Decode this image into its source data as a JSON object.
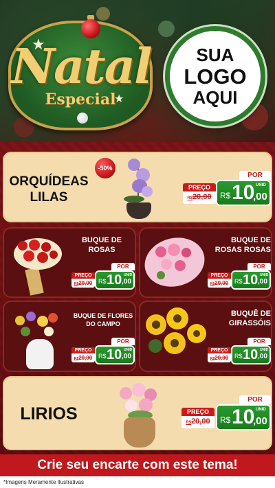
{
  "header": {
    "seal_title": "Natal",
    "seal_subtitle": "Especial",
    "logo_lines": [
      "SUA",
      "LOGO",
      "AQUI"
    ]
  },
  "discount_badge": "-50%",
  "products": [
    {
      "name_lines": [
        "ORQUÍDEAS",
        "LILAS"
      ],
      "price_label": "PREÇO",
      "old_price": "20,00",
      "old_currency": "R$",
      "por_label": "POR",
      "currency": "R$",
      "price_int": "10",
      "price_dec": ",00",
      "unit": "UNID"
    },
    {
      "name_lines": [
        "BUQUE DE",
        "ROSAS"
      ],
      "price_label": "PREÇO",
      "old_price": "20,00",
      "old_currency": "R$",
      "por_label": "POR",
      "currency": "R$",
      "price_int": "10",
      "price_dec": ",00",
      "unit": "UNID"
    },
    {
      "name_lines": [
        "BUQUE DE",
        "ROSAS ROSAS"
      ],
      "price_label": "PREÇO",
      "old_price": "20,00",
      "old_currency": "R$",
      "por_label": "POR",
      "currency": "R$",
      "price_int": "10",
      "price_dec": ",00",
      "unit": "UNID"
    },
    {
      "name_lines": [
        "BUQUE DE FLORES",
        "DO CAMPO"
      ],
      "price_label": "PREÇO",
      "old_price": "20,00",
      "old_currency": "R$",
      "por_label": "POR",
      "currency": "R$",
      "price_int": "10",
      "price_dec": ",00",
      "unit": "UNID"
    },
    {
      "name_lines": [
        "BUQUÊ DE",
        "GIRASSÓIS"
      ],
      "price_label": "PREÇO",
      "old_price": "20,00",
      "old_currency": "R$",
      "por_label": "POR",
      "currency": "R$",
      "price_int": "10",
      "price_dec": ",00",
      "unit": "UNID"
    },
    {
      "name_lines": [
        "LIRIOS"
      ],
      "price_label": "PREÇO",
      "old_price": "20,00",
      "old_currency": "R$",
      "por_label": "POR",
      "currency": "R$",
      "price_int": "10",
      "price_dec": ",00",
      "unit": "UNID"
    }
  ],
  "footer": {
    "banner": "Crie seu encarte com este tema!",
    "note": "*Imagens Meramente Ilustrativas"
  },
  "colors": {
    "accent_red": "#c0181c",
    "price_green": "#1f8a23",
    "card_cream": "#f5dcae",
    "card_dark": "#5b0f10"
  }
}
